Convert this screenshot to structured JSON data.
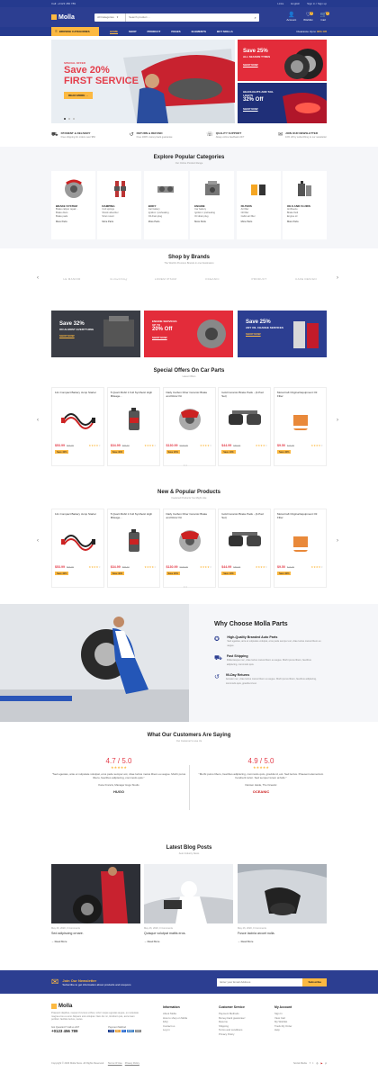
{
  "topbar": {
    "phone": "Call: +0123 456 789",
    "links": [
      "Links",
      "English",
      "Sign in / Sign up"
    ]
  },
  "header": {
    "logo": "Molla",
    "search": {
      "category": "All Categories",
      "placeholder": "Search product ..."
    },
    "icons": [
      {
        "label": "Account"
      },
      {
        "label": "Wishlist",
        "count": "3"
      },
      {
        "label": "Cart",
        "count": "2"
      }
    ]
  },
  "nav": {
    "browse": "BROWSE CATEGORIES",
    "links": [
      "HOME",
      "SHOP",
      "PRODUCT",
      "PAGES",
      "ELEMENTS",
      "BUY MOLLA"
    ],
    "clearance_prefix": "Clearance Up to",
    "clearance_value": "30% Off"
  },
  "hero": {
    "offer": "SPECIAL OFFER",
    "line1": "Save 20%",
    "line2": "FIRST SERVICE",
    "button": "READ MORE"
  },
  "side_banners": [
    {
      "title": "Save 25%",
      "sub": "ALL SEASON TYRES",
      "link": "SHOP NOW"
    },
    {
      "title": "HEADLIGHTS AND TAIL LIGHTS",
      "sub": "32% Off",
      "link": "SHOP NOW"
    }
  ],
  "features": [
    {
      "title": "PAYMENT & DELIVERY",
      "desc": "Free shipping for orders over $50"
    },
    {
      "title": "RETURN & REFUND",
      "desc": "Free 100% money back guarantee"
    },
    {
      "title": "QUALITY SUPPORT",
      "desc": "Alway online feedback 24/7"
    },
    {
      "title": "JOIN OUR NEWSLETTER",
      "desc": "10% off by subscribing to our newsletter"
    }
  ],
  "categories": {
    "title": "Explore Popular Categories",
    "subtitle": "Our Online Product Range",
    "items": [
      {
        "name": "BRAKE SYSTEM",
        "items": [
          "Brake caliper repair...",
          "Brake discs",
          "Brake pads"
        ],
        "more": "More Parts"
      },
      {
        "name": "DAMPING",
        "items": [
          "Coil springs",
          "Shock absorber",
          "Strut mount"
        ],
        "more": "More Parts"
      },
      {
        "name": "BODY",
        "items": [
          "Car battery",
          "Ignition / preheating",
          "Oil drain plug"
        ],
        "more": "More Parts"
      },
      {
        "name": "ENGINE",
        "items": [
          "Car battery",
          "Ignition / preheating",
          "Oil drain plug"
        ],
        "more": "More Parts"
      },
      {
        "name": "FILTERS",
        "items": [
          "Air filter",
          "Oil filter",
          "Cabin air filter"
        ],
        "more": "More Parts"
      },
      {
        "name": "OILS AND FLUIDS",
        "items": [
          "Antifreeze",
          "Brake fluid",
          "Engine oil"
        ],
        "more": "More Parts"
      }
    ]
  },
  "brands": {
    "title": "Shop by Brands",
    "subtitle": "The World's Premium Brands in one Destination",
    "items": [
      "LE MANOIR",
      "Something",
      "LOREM IPSUM",
      "OCEANIC",
      "PRODUCT",
      "CAFE DESIGN"
    ]
  },
  "promos": [
    {
      "line1": "Save 32%",
      "line2": "ON ALMOST EVERYTHING",
      "link": "SHOP NOW",
      "color": "#3a3d45"
    },
    {
      "line1": "ENGINE SERVICES",
      "line2": "UP TO",
      "line3": "20% Off",
      "link": "SHOP NOW",
      "color": "#e32c3a"
    },
    {
      "line1": "Save 25%",
      "line2": "ANY OIL CHANGE SERVICES",
      "link": "SHOP NOW",
      "color": "#2c3e91"
    }
  ],
  "special_offers": {
    "title": "Special Offers On Car Parts",
    "subtitle": "Latest Offers"
  },
  "popular": {
    "title": "New & Popular Products",
    "subtitle": "Featured Products You Might Like"
  },
  "products": [
    {
      "name": "12v Compact Battery Jump Starter",
      "price": "$53.99",
      "old": "$99.99",
      "tag": "Save 40%",
      "rating": 4
    },
    {
      "name": "5 Quart Mobil 1 Full Synthetic High Mileage...",
      "price": "$34.99",
      "old": "$65.99",
      "tag": "Save 40%",
      "rating": 4
    },
    {
      "name": "Daily Carbon Fiber Ceramic Brake and Rotor Kit",
      "price": "$130.99",
      "old": "$189.99",
      "tag": "Save 20%",
      "rating": 4
    },
    {
      "name": "Gold Ceramic Brake Pads - (4-Pad Set)",
      "price": "$44.99",
      "old": "$59.99",
      "tag": "Save 10%",
      "rating": 4
    },
    {
      "name": "Motorcraft Original Equipment Oil Filter",
      "price": "$9.50",
      "old": "$14.99",
      "tag": "Save 40%",
      "rating": 4
    }
  ],
  "why": {
    "title": "Why Choose Molla Parts",
    "items": [
      {
        "title": "High-Quality Branded Auto Parts",
        "desc": "Sed egestas, ante et vulputate volutpat, eros pede semper est, vitae luctus metus libero eu augue."
      },
      {
        "title": "Fast Shipping",
        "desc": "Pellentesque nec, vitae luctus metus libero eu augue. Morbi purus libero, faucibus adipiscing, commodo quis."
      },
      {
        "title": "90-Day Returns",
        "desc": "Aenean nec, vitae luctus metus libero eu augue. Morbi purus libero, faucibus adipiscing, commodo quis, gravida id est."
      }
    ]
  },
  "testimonials": {
    "title": "What Our Customers Are Saying",
    "subtitle": "Our Customer's Love Us",
    "items": [
      {
        "rating": "4.7 / 5.0",
        "quote": "\"Sed egestas, ante et vulputate volutpat, eros pede semper est, vitae luctus metus libero eu augue. Morbi purus libero, faucibus adipiscing, commodo quis.\"",
        "author": "Kane Francis, Manager Hugo Studio",
        "logo": "HUGO"
      },
      {
        "rating": "4.9 / 5.0",
        "quote": "\"Morbi purus libero, faucibus adipiscing, commodo quis, gravida id, est. Sed lectus. Praesent elementum hendrerit tortor. Sed semper lorem at felis.\"",
        "author": "Damien Heide, The Oceanic",
        "logo": "OCEANIC"
      }
    ]
  },
  "blog": {
    "title": "Latest Blog Posts",
    "subtitle": "Auto Industry News",
    "posts": [
      {
        "meta": "May 26, 2020, 0 Comments",
        "title": "Sed adipiscing ornare.",
        "more": "Read More"
      },
      {
        "meta": "May 26, 2020, 0 Comments",
        "title": "Quisque volutpat mattis eros.",
        "more": "Read More"
      },
      {
        "meta": "May 26, 2020, 0 Comments",
        "title": "Fusce lacinia arcuet nulla.",
        "more": "Read More"
      }
    ]
  },
  "newsletter": {
    "title": "Join Our Newsletter",
    "desc": "Subscribe to get information about products and coupons",
    "placeholder": "Enter your Email Address",
    "button": "Subscribe"
  },
  "footer": {
    "logo": "Molla",
    "about": "Praesent dapibus, neque id cursus ucibus, tortor neque egestas augue, eu vulputate magna eros eu erat. Aliquam erat volutpat. Nam dui mi, tincidunt quis, accumsan porttitor, facilisis luctus, metus.",
    "question": "Got Question? Call us 24/7",
    "phone": "+0123 456 789",
    "payment_label": "Payment Method",
    "payments": [
      "VISA",
      "MC",
      "PP",
      "AMEX",
      "DISC"
    ],
    "columns": [
      {
        "title": "Information",
        "links": [
          "About Molla",
          "How to shop on Molla",
          "FAQ",
          "Contact us",
          "Log in"
        ]
      },
      {
        "title": "Customer Service",
        "links": [
          "Payment Methods",
          "Money-back guarantee!",
          "Returns",
          "Shipping",
          "Terms and conditions",
          "Privacy Policy"
        ]
      },
      {
        "title": "My Account",
        "links": [
          "Sign In",
          "View Cart",
          "My Wishlist",
          "Track My Order",
          "Help"
        ]
      }
    ],
    "copyright": "Copyright © 2023 Molla Store. All Rights Reserved.",
    "bottom_links": [
      "Terms Of Use",
      "Privacy Policy"
    ],
    "social_label": "Social Media"
  },
  "colors": {
    "primary": "#2c3e91",
    "accent": "#fcb941",
    "sale": "#e43d4a"
  }
}
